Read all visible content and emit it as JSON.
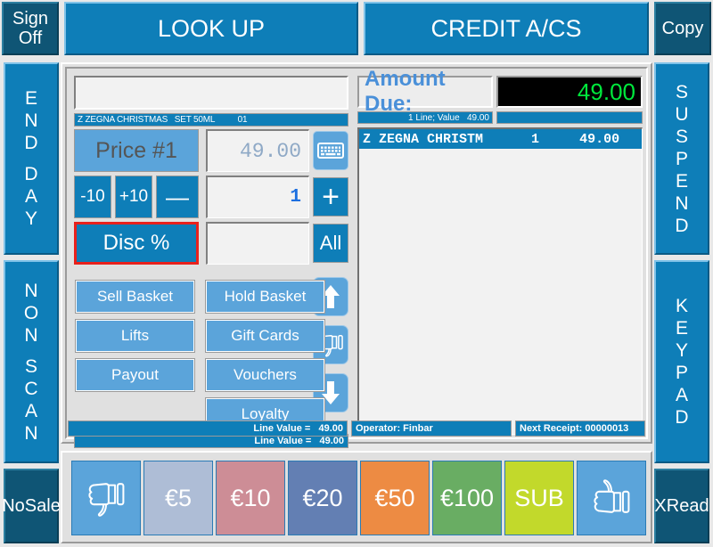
{
  "topbar": {
    "sign_off": [
      "Sign",
      "Off"
    ],
    "look_up": "LOOK UP",
    "credit_accounts": "CREDIT A/CS",
    "copy": "Copy"
  },
  "left_rail": {
    "end_day": [
      "E",
      "N",
      "D",
      "",
      "D",
      "A",
      "Y"
    ],
    "non_scan": [
      "N",
      "O",
      "N",
      "",
      "S",
      "C",
      "A",
      "N"
    ],
    "no_sale": [
      "No",
      "Sale"
    ]
  },
  "right_rail": {
    "suspend": [
      "S",
      "U",
      "S",
      "P",
      "E",
      "N",
      "D"
    ],
    "keypad": [
      "K",
      "E",
      "Y",
      "P",
      "A",
      "D"
    ],
    "x_read": [
      "X",
      "Read"
    ]
  },
  "entry": {
    "description_input_value": "",
    "description_input_placeholder": "",
    "item_description_bar": "Z ZEGNA CHRISTMAS   SET 50ML          01",
    "price_label": "Price #1",
    "price_value": "49.00",
    "keyboard_icon": "keyboard-icon",
    "minus_ten_label": "-10",
    "plus_ten_label": "+10",
    "minus_label": "—",
    "quantity_value": "1",
    "plus_label": "+",
    "discount_label": "Disc %",
    "discount_value": "",
    "all_label": "All",
    "scroll_up_icon": "arrow-up-icon",
    "thumb_down_icon": "thumbs-down-icon",
    "scroll_down_icon": "arrow-down-icon"
  },
  "function_buttons": [
    {
      "label": "Sell Basket",
      "name": "sell-basket-button"
    },
    {
      "label": "Hold Basket",
      "name": "hold-basket-button"
    },
    {
      "label": "Lifts",
      "name": "lifts-button"
    },
    {
      "label": "Gift Cards",
      "name": "gift-cards-button"
    },
    {
      "label": "Payout",
      "name": "payout-button"
    },
    {
      "label": "Vouchers",
      "name": "vouchers-button"
    },
    {
      "label": "Loyalty",
      "name": "loyalty-button"
    }
  ],
  "line_value_bar": "Line Value =   49.00",
  "receipt": {
    "amount_due_label": "Amount Due:",
    "amount_due_value": "49.00",
    "line_count_text": "1 Line; Value   49.00",
    "rows": [
      {
        "description": "Z ZEGNA CHRISTM",
        "qty": "1",
        "value": "49.00"
      }
    ]
  },
  "status": {
    "line_value": "Line Value =   49.00",
    "operator": "Operator: Finbar",
    "next_receipt": "Next Receipt: 00000013"
  },
  "tender_buttons": [
    {
      "label": "",
      "icon": "thumbs-down-icon",
      "name": "void-tender-button",
      "color": "#5ba4da"
    },
    {
      "label": "€5",
      "icon": "",
      "name": "tender-5-button",
      "color": "#aebdd6"
    },
    {
      "label": "€10",
      "icon": "",
      "name": "tender-10-button",
      "color": "#cd8d96"
    },
    {
      "label": "€20",
      "icon": "",
      "name": "tender-20-button",
      "color": "#637fb3"
    },
    {
      "label": "€50",
      "icon": "",
      "name": "tender-50-button",
      "color": "#ed8b43"
    },
    {
      "label": "€100",
      "icon": "",
      "name": "tender-100-button",
      "color": "#69ad63"
    },
    {
      "label": "SUB",
      "icon": "",
      "name": "subtotal-button",
      "color": "#c2d92b"
    },
    {
      "label": "",
      "icon": "thumbs-up-icon",
      "name": "confirm-tender-button",
      "color": "#5ba4da"
    }
  ],
  "colors": {
    "accent_blue": "#0e7eb8",
    "light_blue": "#5ba4da",
    "navy": "#0f5575",
    "amount_green": "#00e83c",
    "highlight_red": "#e8211c",
    "panel_gray": "#e0e0e0"
  }
}
